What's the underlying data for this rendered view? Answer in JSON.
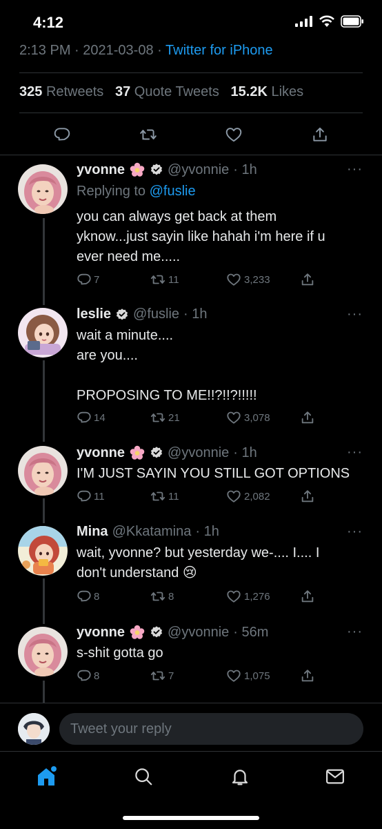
{
  "status_bar": {
    "time": "4:12"
  },
  "tweet_meta": {
    "time": "2:13 PM",
    "sep1": "·",
    "date": "2021-03-08",
    "sep2": "·",
    "source": "Twitter for iPhone"
  },
  "stats": {
    "retweets_count": "325",
    "retweets_label": "Retweets",
    "quotes_count": "37",
    "quotes_label": "Quote Tweets",
    "likes_count": "15.2K",
    "likes_label": "Likes"
  },
  "replies": [
    {
      "name": "yvonne",
      "handle": "@yvonnie",
      "time": "· 1h",
      "replying_to_label": "Replying to",
      "replying_to": "@fuslie",
      "text": "you can always get back at them\nyknow...just sayin like hahah i'm here if u\never need me.....",
      "reply_count": "7",
      "retweet_count": "11",
      "like_count": "3,233"
    },
    {
      "name": "leslie",
      "handle": "@fuslie",
      "time": "· 1h",
      "text": "wait a minute....\nare you....\n\nPROPOSING TO ME!!?!!?!!!!!",
      "reply_count": "14",
      "retweet_count": "21",
      "like_count": "3,078"
    },
    {
      "name": "yvonne",
      "handle": "@yvonnie",
      "time": "· 1h",
      "text": "I'M JUST SAYIN YOU STILL GOT OPTIONS",
      "reply_count": "11",
      "retweet_count": "11",
      "like_count": "2,082"
    },
    {
      "name": "Mina",
      "handle": "@Kkatamina",
      "time": "· 1h",
      "text": "wait, yvonne? but yesterday we-.... I.... I\ndon't understand 😢",
      "reply_count": "8",
      "retweet_count": "8",
      "like_count": "1,276"
    },
    {
      "name": "yvonne",
      "handle": "@yvonnie",
      "time": "· 56m",
      "text": "s-shit gotta go",
      "reply_count": "8",
      "retweet_count": "7",
      "like_count": "1,075"
    }
  ],
  "more_label": "···",
  "reply_box": {
    "placeholder": "Tweet your reply"
  },
  "colors": {
    "accent": "#1d9bf0",
    "background": "#000000",
    "muted": "#6e767d",
    "text": "#e7e9ea"
  },
  "icons": [
    "reply-icon",
    "retweet-icon",
    "like-icon",
    "share-icon",
    "verified-icon",
    "flower-icon",
    "home-icon",
    "search-icon",
    "notifications-icon",
    "messages-icon"
  ]
}
